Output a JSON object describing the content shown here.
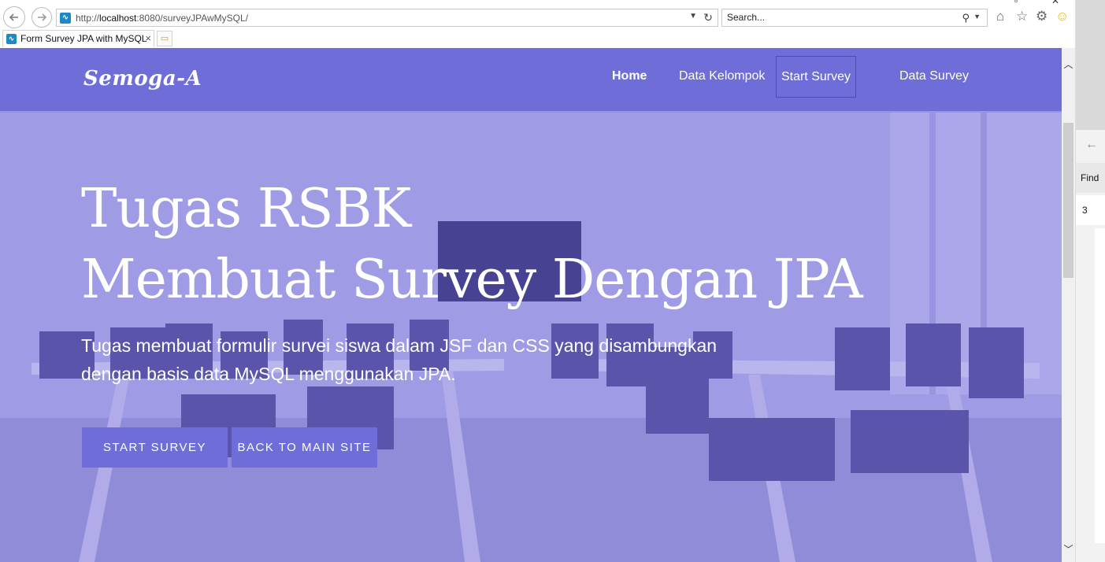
{
  "browser": {
    "url_prefix": "http://",
    "url_host": "localhost",
    "url_rest": ":8080/surveyJPAwMySQL/",
    "search_placeholder": "Search...",
    "tab_title": "Form Survey JPA with MySQL",
    "tab_close": "×",
    "site_icon_glyph": "∿"
  },
  "navbar": {
    "brand": "Semoga-A",
    "links": [
      "Home",
      "Data Kelompok",
      "Start Survey",
      "Data Survey"
    ]
  },
  "hero": {
    "title_line1": "Tugas RSBK",
    "title_line2": "Membuat Survey Dengan JPA",
    "subtitle_line1": "Tugas membuat formulir survei siswa dalam JSF dan CSS yang disambungkan",
    "subtitle_line2": "dengan basis data MySQL menggunakan JPA.",
    "cta_primary": "START SURVEY",
    "cta_secondary": "BACK TO MAIN SITE"
  },
  "side_pane": {
    "find_label": "Find",
    "match_count": "3"
  },
  "colors": {
    "accent": "#6f6ed8",
    "hero_tint": "#b2b0e6"
  }
}
